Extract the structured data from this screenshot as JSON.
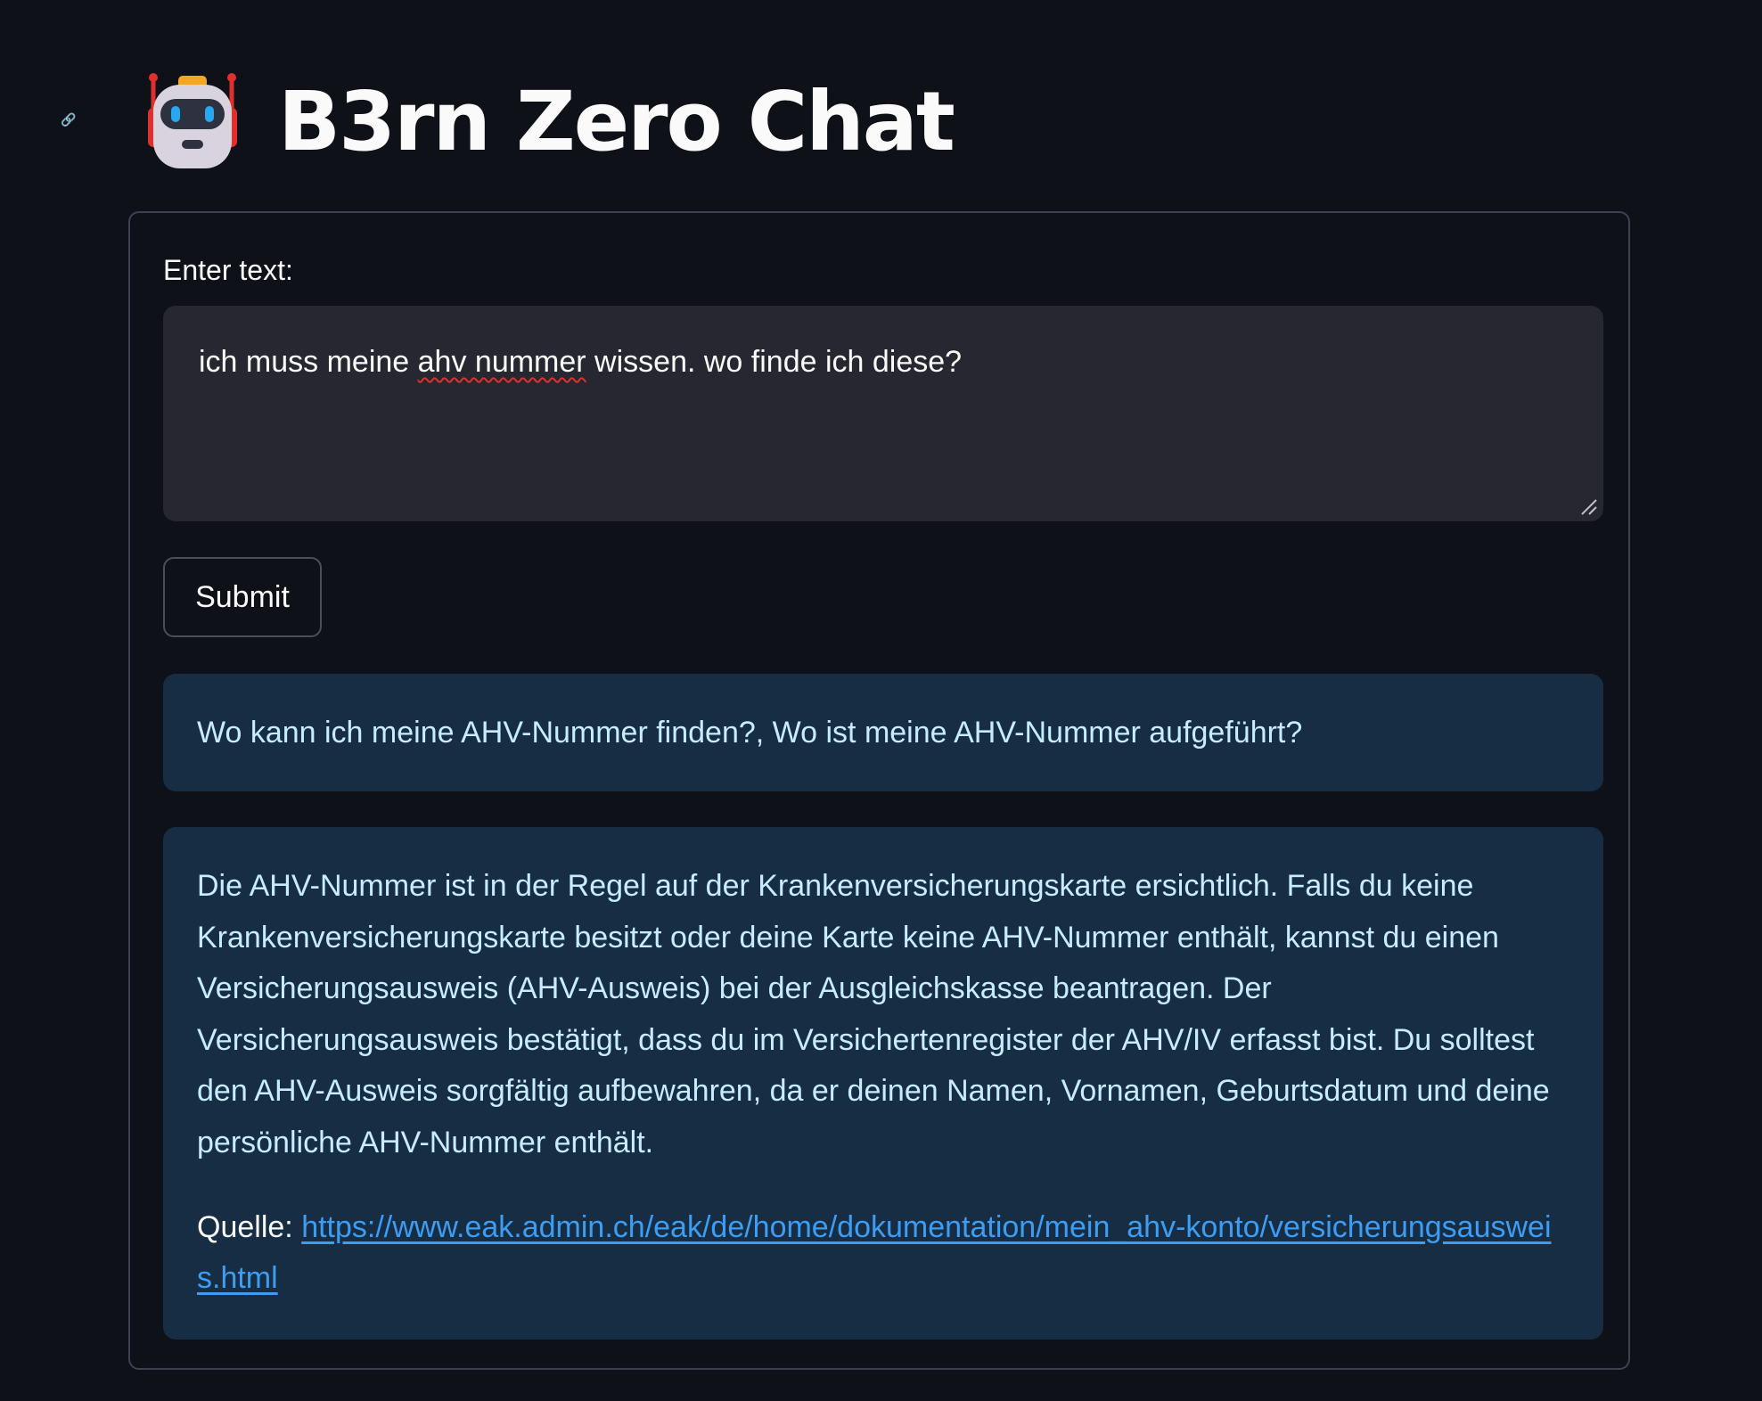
{
  "header": {
    "title": "B3rn Zero Chat",
    "icon": "robot-emoji"
  },
  "form": {
    "input_label": "Enter text:",
    "input_value_before": "ich muss meine ",
    "input_value_misspelled": "ahv nummer",
    "input_value_after": " wissen. wo finde ich diese?",
    "submit_label": "Submit"
  },
  "results": {
    "questions": "Wo kann ich meine AHV-Nummer finden?, Wo ist meine AHV-Nummer aufgeführt?",
    "answer": "Die AHV-Nummer ist in der Regel auf der Krankenversicherungskarte ersichtlich. Falls du keine Krankenversicherungskarte besitzt oder deine Karte keine AHV-Nummer enthält, kannst du einen Versicherungsausweis (AHV-Ausweis) bei der Ausgleichskasse beantragen. Der Versicherungsausweis bestätigt, dass du im Versichertenregister der AHV/IV erfasst bist. Du solltest den AHV-Ausweis sorgfältig aufbewahren, da er deinen Namen, Vornamen, Geburtsdatum und deine persönliche AHV-Nummer enthält.",
    "source_label": "Quelle:",
    "source_url": "https://www.eak.admin.ch/eak/de/home/dokumentation/mein_ahv-konto/versicherungsausweis.html"
  },
  "colors": {
    "background": "#0e1117",
    "info_box": "#172d43",
    "info_text": "#c7ebff",
    "link": "#3d9df3",
    "input_bg": "#262730"
  }
}
